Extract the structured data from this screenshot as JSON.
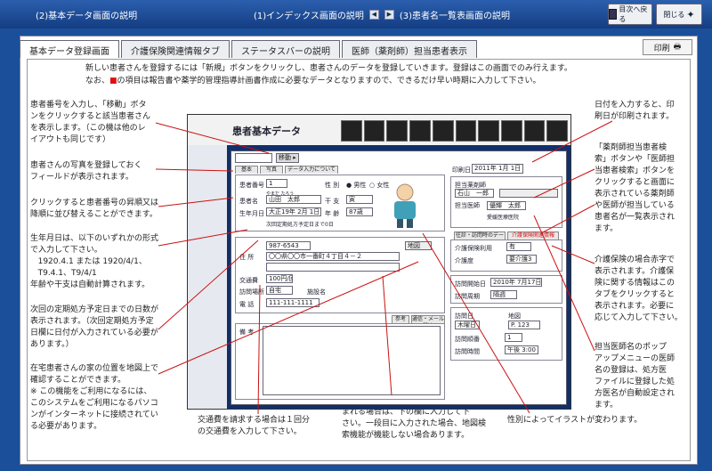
{
  "header": {
    "left_title": "(2)基本データ画面の説明",
    "prev_link": "(1)インデックス画面の説明",
    "prev_arrow": "◀",
    "next_arrow": "▶",
    "next_link": "(3)患者名一覧表画面の説明",
    "back_to_index": "目次へ戻る",
    "close": "閉じる"
  },
  "tabs": [
    "基本データ登録画面",
    "介護保険関連情報タブ",
    "ステータスバーの説明",
    "医師（薬剤師）担当患者表示"
  ],
  "print_button": "印刷",
  "intro": {
    "line1": "新しい患者さんを登録するには「新規」ボタンをクリックし、患者さんのデータを登録していきます。登録はこの画面でのみ行えます。",
    "line2_pre": "なお、",
    "line2_mark": "■",
    "line2_post": "の項目は報告書や薬学的管理指導計画書作成に必要なデータとなりますので、できるだけ早い時期に入力して下さい。"
  },
  "notes": {
    "move": "患者番号を入力し、「移動」ボタ\nンをクリックすると該当患者さん\nを表示します。（この機は他のレ\nイアウトも同じです）",
    "photo": "患者さんの写真を登録しておく\nフィールドが表示されます。",
    "sort": "クリックすると患者番号の昇順又は\n降順に並び替えることができます。",
    "birthday": "生年月日は、以下のいずれかの形式\nで入力して下さい。\n   1920.4.1 または 1920/4/1、\n   T9.4.1、T9/4/1\n年齢や干支は自動計算されます。",
    "prescription": "次回の定期処方予定日までの日数が\n表示されます。（次回定期処方予定\n日欄に日付が入力されている必要が\nあります。）",
    "map": "在宅患者さんの家の位置を地図上で\n確認することができます。\n※ この機能をご利用になるには、\nこのシステムをご利用になるパソコ\nンがインターネットに接続されてい\nる必要があります。",
    "transport": "交通費を請求する場合は１回分\nの交通費を入力して下さい。",
    "address": "住所にマンション名やコーポ名が含\nまれる場合は、下の欄に入力して下\nさい。一段目に入力された場合、地図検\n索機能が機能しない場合あります。",
    "gender": "性別によってイラストが変わります。",
    "date": "日付を入力すると、印\n刷日が印刷されます。",
    "pharmacist": "「薬剤師担当患者検\n索」ボタンや「医師担\n当患者検索」ボタンを\nクリックすると画面に\n表示されている薬剤師\nや医師が担当している\n患者名が一覧表示され\nます。",
    "care": "介護保険の場合赤字で\n表示されます。介護保\n険に関する情報はこの\nタブをクリックすると\n表示されます。必要に\n応じて入力して下さい。",
    "doctor": "担当医師名のポップ\nアップメニューの医師\n名の登録は、処方医\nファイルに登録した処\n方医名が自動設定され\nます。"
  },
  "screenshot": {
    "title": "患者基本データ",
    "move_btn": "移動 ▸",
    "sub_tabs": [
      "基本",
      "写真",
      "データ入力について"
    ],
    "print_date_label": "印刷日",
    "print_date": "2011年 1月 1日",
    "patient_no_label": "患者番号",
    "patient_no": "1",
    "gender_label": "性 別",
    "gender_male": "男性",
    "gender_female": "女性",
    "furigana": "やまだ たろう",
    "name_label": "患者名",
    "name": "山田　太郎",
    "eto_label": "干 支",
    "eto": "寅",
    "birth_label": "生年月日",
    "birth": "大正19年 2月 1日",
    "age_label": "年 齢",
    "age": "87歳",
    "next_days": "次回定期処方予定日まで0日",
    "zip": "987-6543",
    "address_label": "住 所",
    "address": "〇〇県〇〇市一番町４丁目４－２",
    "map_btn": "地図",
    "transport_label": "交通費",
    "transport": "100円/回",
    "visit_label": "訪問場所",
    "visit": "自宅",
    "facility_label": "施設名",
    "phone_label": "電 話",
    "phone": "111-111-1111",
    "remarks_label": "備 考",
    "memo_tabs": [
      "参考",
      "通信・メール関連"
    ],
    "pharmacist_label": "担当薬剤師",
    "pharmacist": "石山　一郎",
    "doctor_label": "担当医師",
    "doctor": "優輝　太郎",
    "clinic": "愛媛医療医院",
    "tab_visit": "往診・訪問時のデータ",
    "tab_care": "介護保険関連情報",
    "care_level_label": "介護保険利用",
    "care_level": "有",
    "care_grade_label": "介護度",
    "care_grade": "要介護3",
    "start_label": "訪問開始日",
    "start_date": "2010年 7月17日",
    "cycle_label": "訪問周期",
    "cycle": "隔週",
    "visit_day_label": "訪問日",
    "visit_day": "木曜日",
    "visit_no_label": "地図",
    "visit_no": "P. 123",
    "route_label": "訪問順番",
    "route": "1",
    "time_label": "訪問時間",
    "time": "午後 3:00"
  },
  "colors": {
    "header": "#1b4f9a",
    "required_mark": "#dd1111",
    "leader": "#cc1111"
  }
}
